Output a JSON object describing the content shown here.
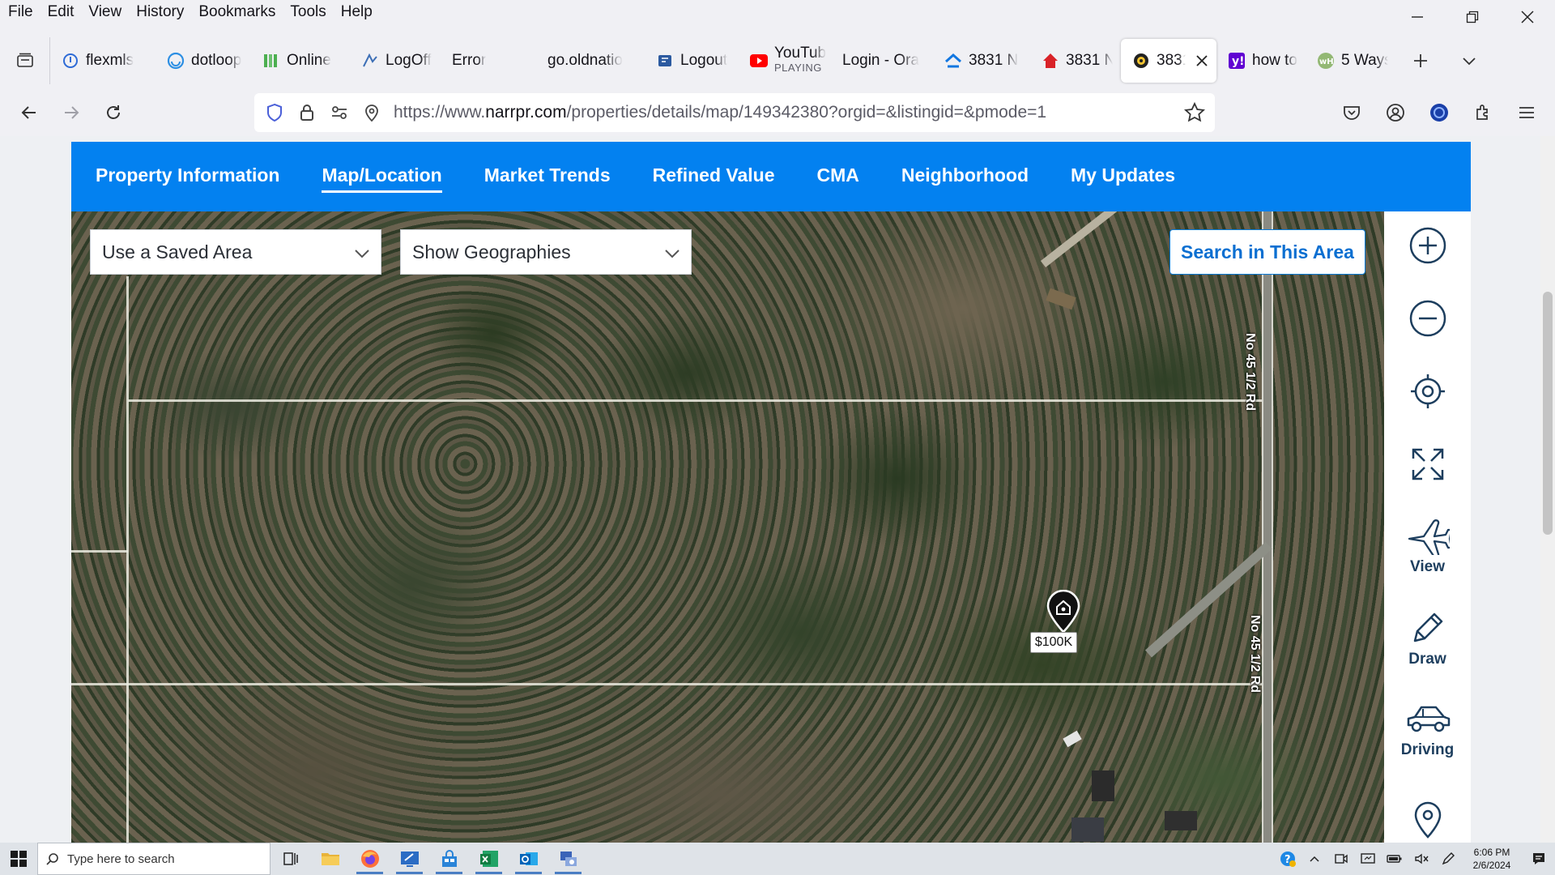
{
  "menubar": [
    "File",
    "Edit",
    "View",
    "History",
    "Bookmarks",
    "Tools",
    "Help"
  ],
  "tabs": [
    {
      "title": "flexmls",
      "icon": "flexmls-icon",
      "color": "#2e6bd6"
    },
    {
      "title": "dotloop",
      "icon": "dotloop-icon",
      "color": "#2d8fe3"
    },
    {
      "title": "Online",
      "icon": "online-icon",
      "color": "#4caf50"
    },
    {
      "title": "LogOff",
      "icon": "logoff-icon",
      "color": "#3d6fb6"
    },
    {
      "title": "Error",
      "icon": "",
      "color": ""
    },
    {
      "title": "go.oldnatio",
      "icon": "",
      "color": ""
    },
    {
      "title": "Logout",
      "icon": "logout-icon",
      "color": "#2c5aa0"
    },
    {
      "title": "YouTub",
      "sub": "PLAYING",
      "icon": "youtube-icon",
      "color": "#ff0000"
    },
    {
      "title": "Login - Ora",
      "icon": "",
      "color": ""
    },
    {
      "title": "3831 N",
      "icon": "zillow-icon",
      "color": "#1277e1"
    },
    {
      "title": "3831 N",
      "icon": "realtor-icon",
      "color": "#d92228"
    },
    {
      "title": "3831",
      "icon": "narrpr-icon",
      "color": "#222222",
      "active": true
    },
    {
      "title": "how to",
      "icon": "yahoo-icon",
      "color": "#6001d2"
    },
    {
      "title": "5 Ways",
      "icon": "wikihow-icon",
      "color": "#93b874"
    }
  ],
  "url": {
    "prefix": "https://www.",
    "host": "narrpr.com",
    "path": "/properties/details/map/149342380?orgid=&listingid=&pmode=1"
  },
  "property_tabs": [
    "Property Information",
    "Map/Location",
    "Market Trends",
    "Refined Value",
    "CMA",
    "Neighborhood",
    "My Updates"
  ],
  "map": {
    "saved_area": "Use a Saved Area",
    "geographies": "Show Geographies",
    "search_button": "Search in This Area",
    "road_label": "No 45 1/2 Rd",
    "road_label_lower": "No 45 1/2 Rd",
    "pin_price": "$100K"
  },
  "tools": {
    "view": "View",
    "draw": "Draw",
    "driving": "Driving"
  },
  "taskbar": {
    "search_placeholder": "Type here to search",
    "time": "6:06 PM",
    "date": "2/6/2024"
  },
  "colors": {
    "accent": "#0381f0",
    "button_text": "#0a6fd1",
    "tool_icon": "#1d3e5e"
  }
}
